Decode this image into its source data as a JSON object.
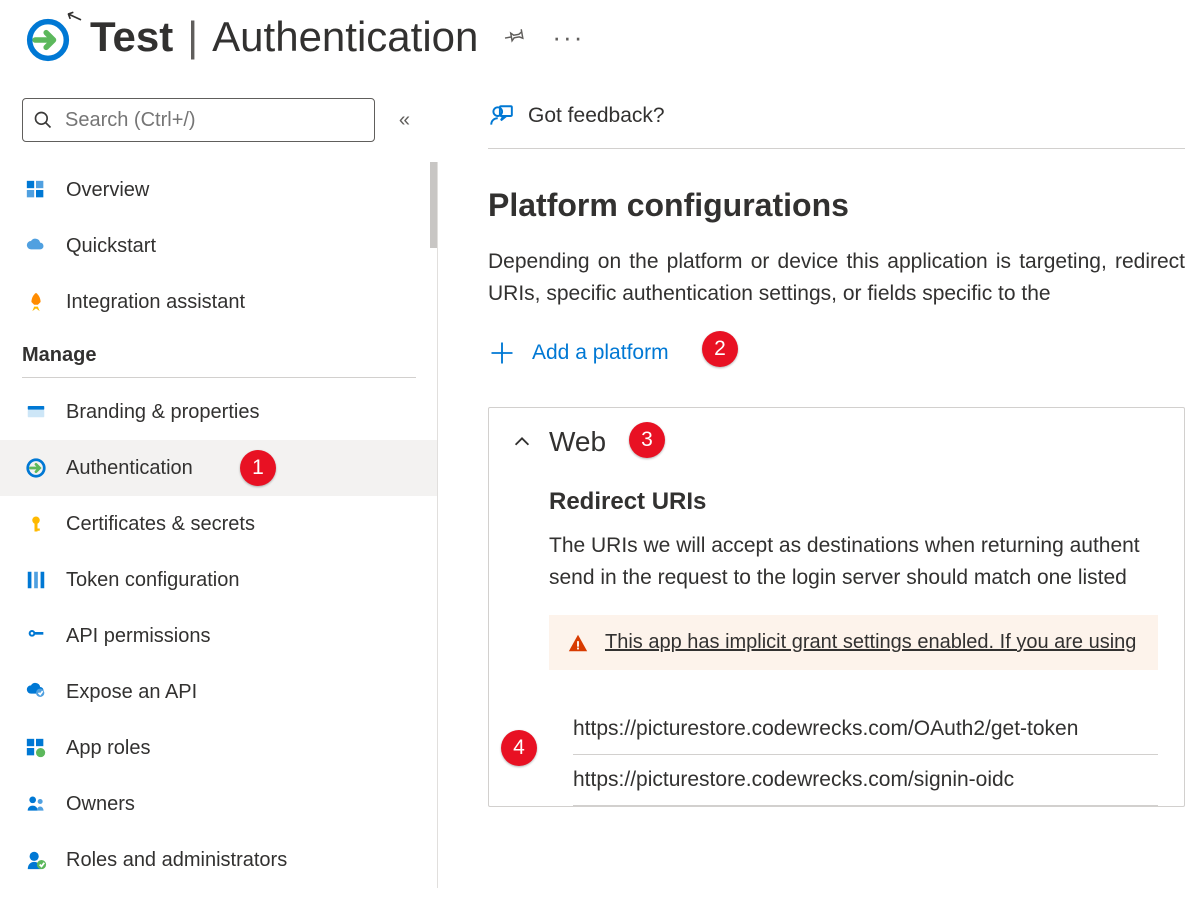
{
  "header": {
    "app_name": "Test",
    "page_name": "Authentication"
  },
  "sidebar": {
    "search_placeholder": "Search (Ctrl+/)",
    "top_items": [
      {
        "label": "Overview",
        "icon": "grid-icon"
      },
      {
        "label": "Quickstart",
        "icon": "cloud-icon"
      },
      {
        "label": "Integration assistant",
        "icon": "rocket-icon"
      }
    ],
    "section": "Manage",
    "manage_items": [
      {
        "label": "Branding & properties",
        "icon": "branding-icon"
      },
      {
        "label": "Authentication",
        "icon": "auth-icon",
        "active": true
      },
      {
        "label": "Certificates & secrets",
        "icon": "key-icon"
      },
      {
        "label": "Token configuration",
        "icon": "bars-icon"
      },
      {
        "label": "API permissions",
        "icon": "api-perm-icon"
      },
      {
        "label": "Expose an API",
        "icon": "expose-api-icon"
      },
      {
        "label": "App roles",
        "icon": "app-roles-icon"
      },
      {
        "label": "Owners",
        "icon": "owners-icon"
      },
      {
        "label": "Roles and administrators",
        "icon": "roles-admin-icon"
      }
    ]
  },
  "content": {
    "feedback_label": "Got feedback?",
    "platform_title": "Platform configurations",
    "platform_desc": "Depending on the platform or device this application is targeting, redirect URIs, specific authentication settings, or fields specific to the",
    "add_platform_label": "Add a platform",
    "web": {
      "title": "Web",
      "redirect_title": "Redirect URIs",
      "redirect_desc": "The URIs we will accept as destinations when returning authent send in the request to the login server should match one listed",
      "warning": "This app has implicit grant settings enabled. If you are using",
      "uris": [
        "https://picturestore.codewrecks.com/OAuth2/get-token",
        "https://picturestore.codewrecks.com/signin-oidc"
      ]
    }
  },
  "annotations": [
    "1",
    "2",
    "3",
    "4"
  ]
}
